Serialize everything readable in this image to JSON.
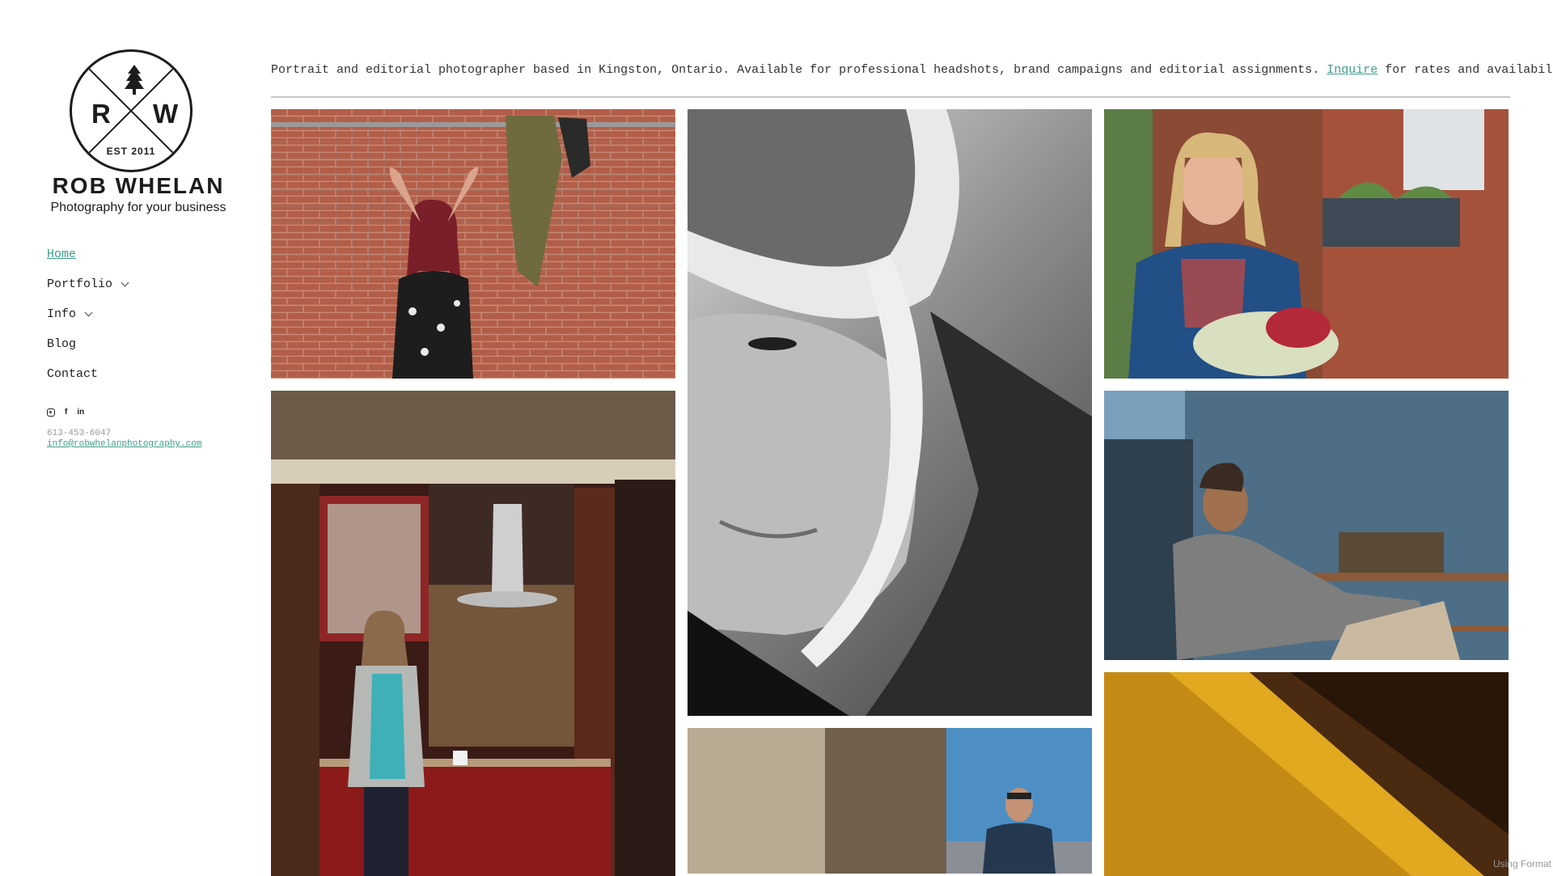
{
  "brand": {
    "logo_r": "R",
    "logo_w": "W",
    "est": "EST 2011",
    "name": "ROB WHELAN",
    "tagline": "Photography for your business"
  },
  "nav": {
    "items": [
      {
        "label": "Home",
        "active": true,
        "has_dropdown": false
      },
      {
        "label": "Portfolio",
        "active": false,
        "has_dropdown": true
      },
      {
        "label": "Info",
        "active": false,
        "has_dropdown": true
      },
      {
        "label": "Blog",
        "active": false,
        "has_dropdown": false
      },
      {
        "label": "Contact",
        "active": false,
        "has_dropdown": false
      }
    ]
  },
  "social": {
    "icons": [
      "instagram-icon",
      "facebook-icon",
      "linkedin-icon"
    ],
    "facebook_glyph": "f",
    "linkedin_glyph": "in"
  },
  "contact": {
    "phone": "613-453-6047",
    "email": "info@robwhelanphotography.com"
  },
  "intro": {
    "before": "Portrait and editorial photographer based in Kingston, Ontario. Available for professional headshots, brand campaigns and editorial assignments. ",
    "link": "Inquire",
    "after": " for rates and availability."
  },
  "colors": {
    "accent": "#3f9c8b",
    "text": "#222222",
    "divider": "#c8c8c8"
  },
  "footer": {
    "credit": "Using Format"
  }
}
